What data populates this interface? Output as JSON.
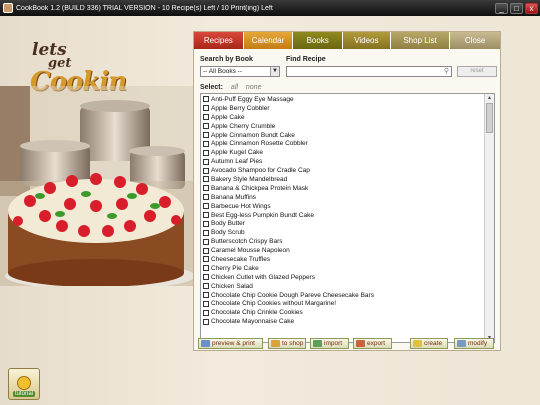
{
  "window": {
    "title": "CookBook 1.2 (BUILD 336) TRIAL VERSION - 10 Recipe(s) Left / 10 Print(ing) Left",
    "minimize": "_",
    "maximize": "□",
    "close": "x"
  },
  "logo": {
    "line1": "lets",
    "line2": "get",
    "line3": "Cookin"
  },
  "tabs": [
    "Recipes",
    "Calendar",
    "Books",
    "Videos",
    "Shop List",
    "Close"
  ],
  "search": {
    "book_label": "Search by Book",
    "book_value": "-- All Books --",
    "find_label": "Find Recipe",
    "find_value": "",
    "reset_label": "reset"
  },
  "select": {
    "label": "Select:",
    "all": "all",
    "none": "none"
  },
  "recipes": [
    "Anti-Puff Eggy Eye Massage",
    "Apple Berry Cobbler",
    "Apple Cake",
    "Apple Cherry Crumble",
    "Apple Cinnamon Bundt Cake",
    "Apple Cinnamon Rosette Cobbler",
    "Apple Kugel Cake",
    "Autumn Leaf Pies",
    "Avocado Shampoo for Cradle Cap",
    "Bakery Style Mandelbread",
    "Banana & Chickpea Protein Mask",
    "Banana Muffins",
    "Barbecue Hot Wings",
    "Best Egg-less Pumpkin Bundt Cake",
    "Body Butter",
    "Body Scrub",
    "Butterscotch Crispy Bars",
    "Caramel Mousse Napoleon",
    "Cheesecake Truffles",
    "Cherry Pie Cake",
    "Chicken Cutlet with Glazed Peppers",
    "Chicken Salad",
    "Chocolate Chip Cookie Dough Pareve Cheesecake Bars",
    "Chocolate Chip Cookies without Margarine!",
    "Chocolate Chip Crinkle Cookies",
    "Chocolate Mayonnaise Cake"
  ],
  "actions": {
    "preview": "preview & print",
    "shop": "to shop",
    "import": "import",
    "export": "export",
    "create": "create",
    "modify": "modify"
  },
  "tutorial": {
    "label": "tutorial"
  }
}
